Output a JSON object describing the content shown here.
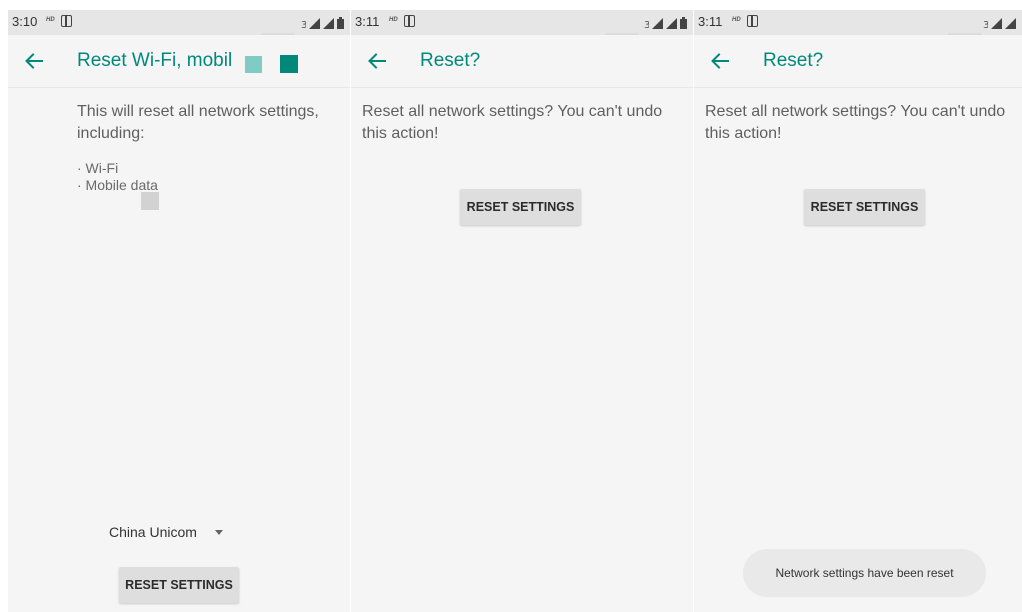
{
  "colors": {
    "accent": "#00897b",
    "accent_light": "#80cbc4",
    "background": "#f5f5f5",
    "status_bar": "#e6e6e6",
    "button": "#dedede"
  },
  "panels": [
    {
      "status": {
        "time": "3:10",
        "hd": "HD",
        "icons": [
          "sim-icon",
          "signal-icon",
          "signal-icon",
          "battery-icon"
        ]
      },
      "app_bar": {
        "back_icon": "arrow-left-icon",
        "title": "Reset Wi-Fi, mobil"
      },
      "description": "This will reset all network settings, including:",
      "bullets": [
        "· Wi-Fi",
        "· Mobile data"
      ],
      "carrier_select": {
        "selected": "China Unicom",
        "icon": "caret-down-icon"
      },
      "button_label": "RESET SETTINGS"
    },
    {
      "status": {
        "time": "3:11",
        "hd": "HD",
        "icons": [
          "sim-icon",
          "signal-icon",
          "signal-icon",
          "battery-icon"
        ]
      },
      "app_bar": {
        "back_icon": "arrow-left-icon",
        "title": "Reset?"
      },
      "description": "Reset all network settings? You can't undo this action!",
      "button_label": "RESET SETTINGS"
    },
    {
      "status": {
        "time": "3:11",
        "hd": "HD",
        "icons": [
          "sim-icon",
          "signal-icon",
          "signal-icon"
        ]
      },
      "app_bar": {
        "back_icon": "arrow-left-icon",
        "title": "Reset?"
      },
      "description": "Reset all network settings? You can't undo this action!",
      "button_label": "RESET SETTINGS",
      "toast": "Network settings have been reset"
    }
  ]
}
